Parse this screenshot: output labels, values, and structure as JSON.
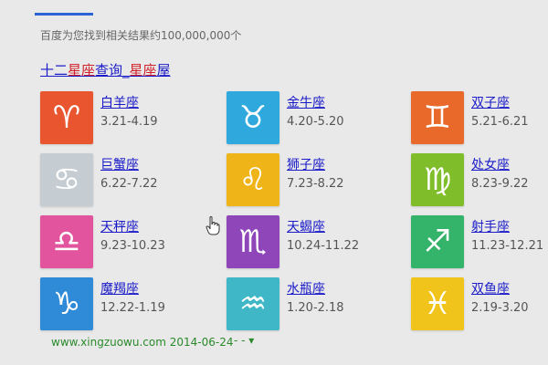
{
  "nav": {
    "tabs": [
      "",
      "",
      "",
      "",
      "",
      ""
    ],
    "active_color": "#2c63d6"
  },
  "result": {
    "count_text": "百度为您找到相关结果约100,000,000个",
    "title_part1": "十二",
    "title_hl1": "星座",
    "title_part2": "查询_",
    "title_hl2": "星座",
    "title_part3": "屋",
    "footer_url": "www.xingzuowu.com 2014-06-24",
    "footer_arrow": "- - ▾"
  },
  "signs": [
    {
      "name": "白羊座",
      "dates": "3.21-4.19",
      "glyph": "♈",
      "color": "#e8552f"
    },
    {
      "name": "金牛座",
      "dates": "4.20-5.20",
      "glyph": "♉",
      "color": "#2fa9dd"
    },
    {
      "name": "双子座",
      "dates": "5.21-6.21",
      "glyph": "♊",
      "color": "#e8692a"
    },
    {
      "name": "巨蟹座",
      "dates": "6.22-7.22",
      "glyph": "♋",
      "color": "#c5cdd2"
    },
    {
      "name": "狮子座",
      "dates": "7.23-8.22",
      "glyph": "♌",
      "color": "#efb417"
    },
    {
      "name": "处女座",
      "dates": "8.23-9.22",
      "glyph": "♍",
      "color": "#7fbd2a"
    },
    {
      "name": "天秤座",
      "dates": "9.23-10.23",
      "glyph": "♎",
      "color": "#e3549e"
    },
    {
      "name": "天蝎座",
      "dates": "10.24-11.22",
      "glyph": "♏",
      "color": "#8e46b9"
    },
    {
      "name": "射手座",
      "dates": "11.23-12.21",
      "glyph": "♐",
      "color": "#34b36b"
    },
    {
      "name": "魔羯座",
      "dates": "12.22-1.19",
      "glyph": "♑",
      "color": "#2f8ad8"
    },
    {
      "name": "水瓶座",
      "dates": "1.20-2.18",
      "glyph": "♒",
      "color": "#3fb7c7"
    },
    {
      "name": "双鱼座",
      "dates": "2.19-3.20",
      "glyph": "♓",
      "color": "#f0c41a"
    }
  ]
}
